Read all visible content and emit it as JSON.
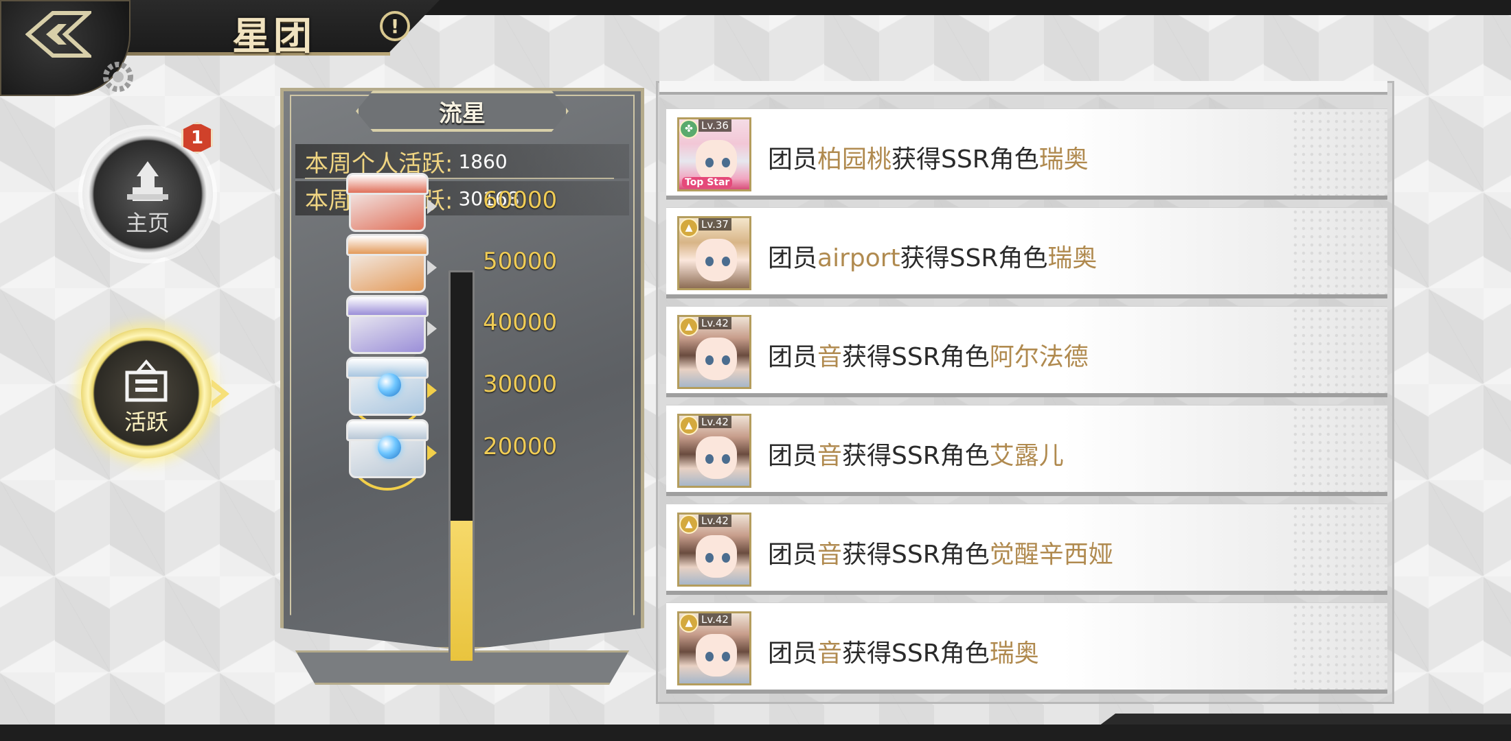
{
  "header": {
    "title": "星团",
    "info_symbol": "!"
  },
  "side_menu": {
    "home": {
      "label": "主页",
      "badge": "1"
    },
    "activity": {
      "label": "活跃"
    }
  },
  "panel": {
    "title": "流星",
    "personal_label": "本周个人活跃:",
    "personal_value": "1860",
    "group_label": "本周星团活跃:",
    "group_value": "30168",
    "progress_fraction": 0.36,
    "tiers": [
      {
        "label": "60000",
        "state": "locked",
        "color": "#e0705a"
      },
      {
        "label": "50000",
        "state": "locked",
        "color": "#e39a5a"
      },
      {
        "label": "40000",
        "state": "locked",
        "color": "#9b8fd8"
      },
      {
        "label": "30000",
        "state": "unlocked",
        "color": "#a9c6e0"
      },
      {
        "label": "20000",
        "state": "unlocked",
        "color": "#b8c7d6"
      }
    ]
  },
  "feed": {
    "rows": [
      {
        "level": "Lv.36",
        "prefix": "团员",
        "member": "柏园桃",
        "mid": "获得SSR角色",
        "character": "瑞奥",
        "avatar_style": "pink",
        "class_icon": "clover-icon",
        "tag": "Top Star"
      },
      {
        "level": "Lv.37",
        "prefix": "团员",
        "member": "airport",
        "mid": "获得SSR角色",
        "character": "瑞奥",
        "avatar_style": "blonde",
        "class_icon": "rocket-icon"
      },
      {
        "level": "Lv.42",
        "prefix": "团员",
        "member": "音",
        "mid": "获得SSR角色",
        "character": "阿尔法德",
        "avatar_style": "brown",
        "class_icon": "rocket-icon"
      },
      {
        "level": "Lv.42",
        "prefix": "团员",
        "member": "音",
        "mid": "获得SSR角色",
        "character": "艾露儿",
        "avatar_style": "brown",
        "class_icon": "rocket-icon"
      },
      {
        "level": "Lv.42",
        "prefix": "团员",
        "member": "音",
        "mid": "获得SSR角色",
        "character": "觉醒辛西娅",
        "avatar_style": "brown",
        "class_icon": "rocket-icon"
      },
      {
        "level": "Lv.42",
        "prefix": "团员",
        "member": "音",
        "mid": "获得SSR角色",
        "character": "瑞奥",
        "avatar_style": "brown",
        "class_icon": "rocket-icon"
      }
    ]
  }
}
